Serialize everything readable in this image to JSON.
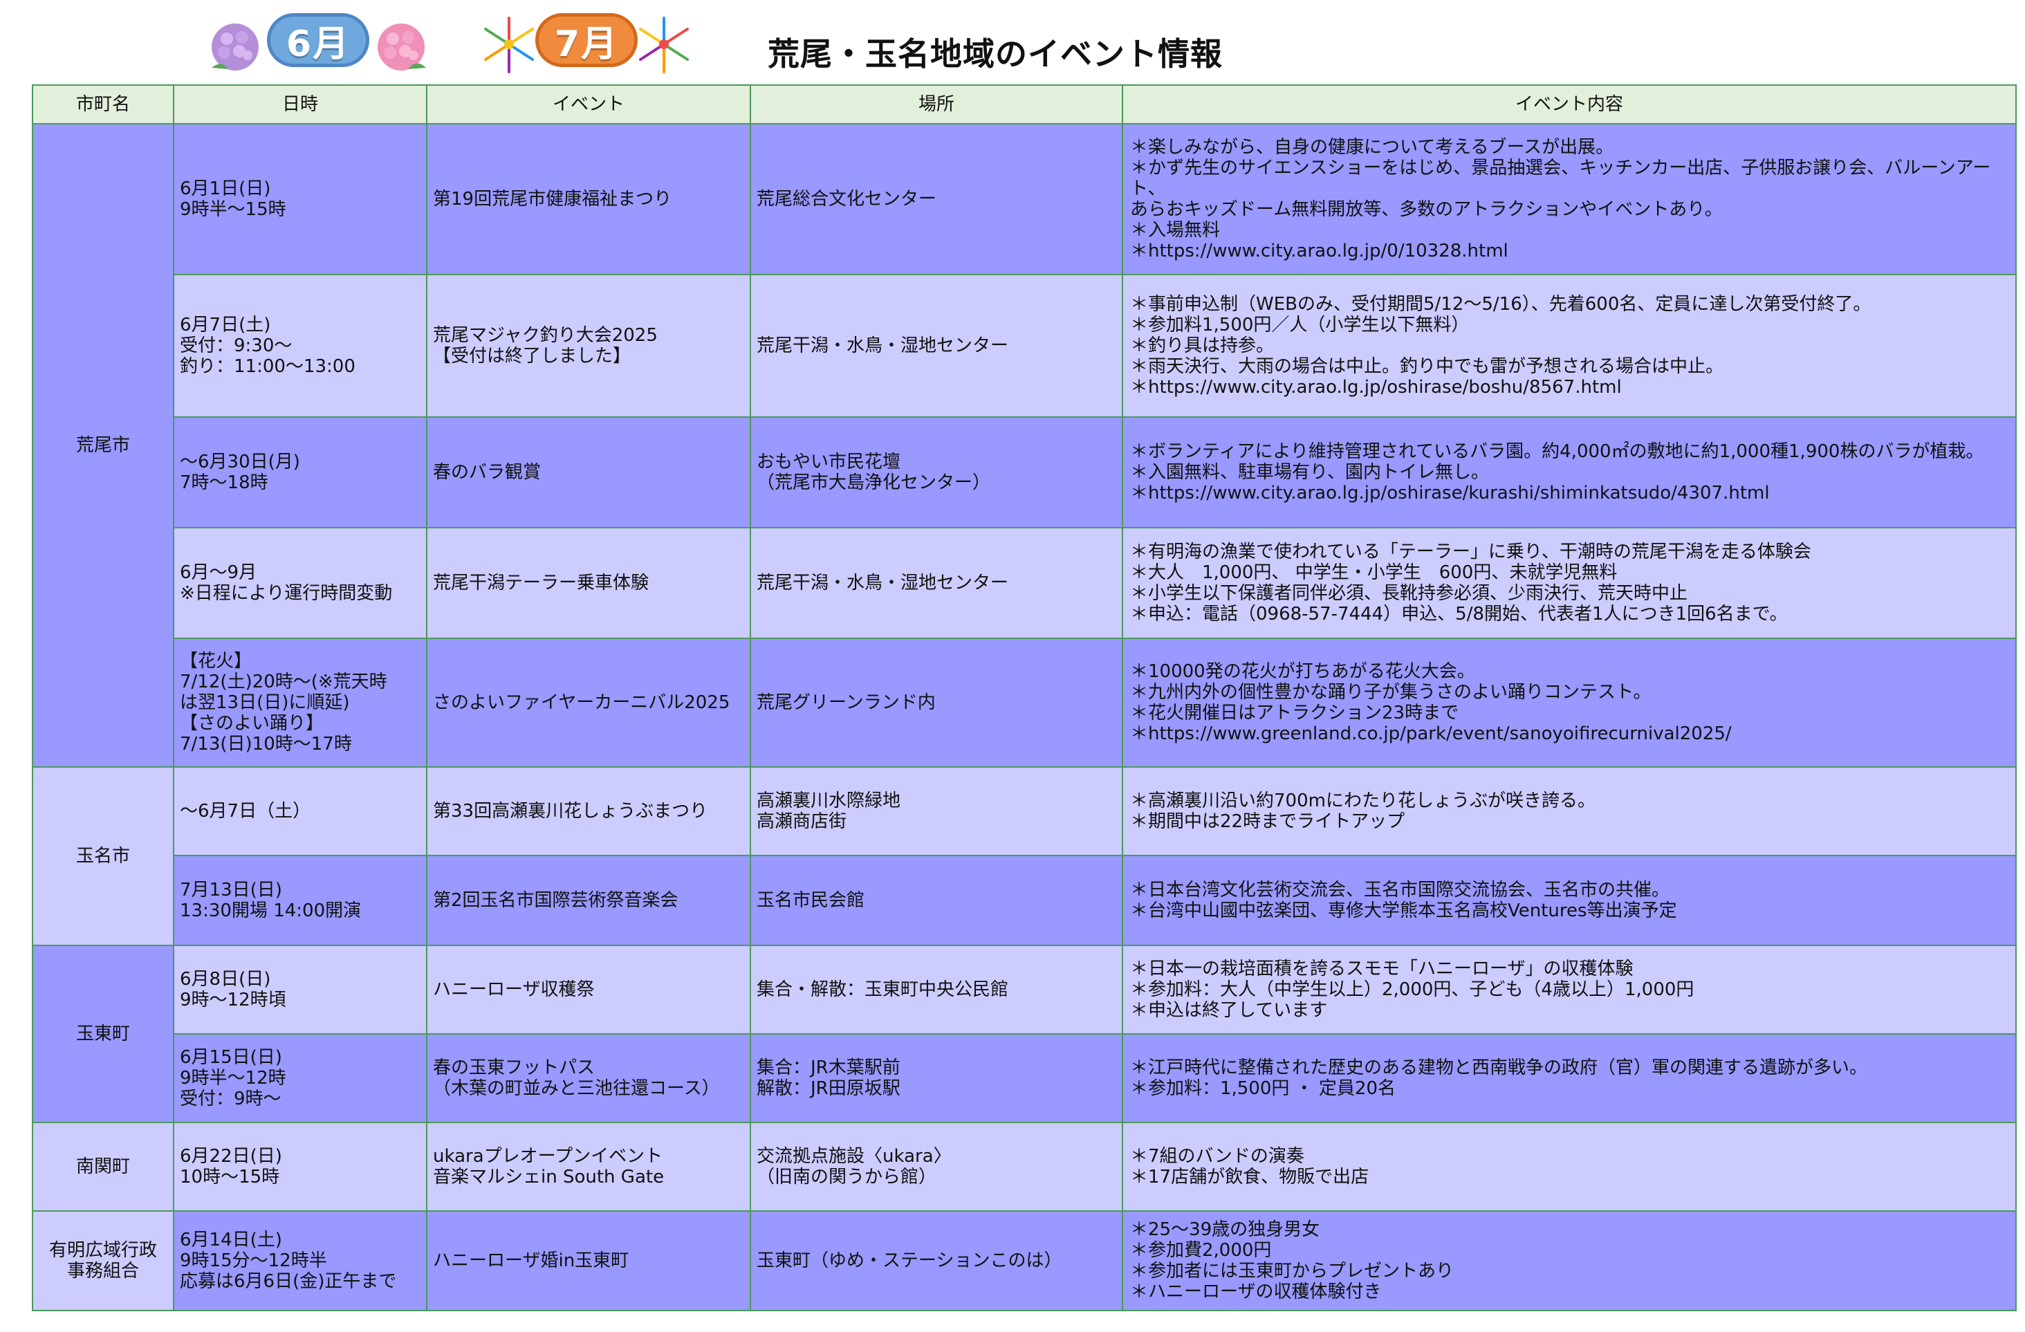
{
  "header": {
    "badges": [
      "6月",
      "7月"
    ],
    "title": "荒尾・玉名地域のイベント情報"
  },
  "colors": {
    "dark_row": "#9999ff",
    "light_row": "#ccccff",
    "header_row": "#e2efda",
    "border": "#4a9a5c"
  },
  "table": {
    "columns": [
      "市町名",
      "日時",
      "イベント",
      "場所",
      "イベント内容"
    ],
    "groups": [
      {
        "municipality": "荒尾市",
        "rows": [
          {
            "date": "6月1日(日)\n  9時半～15時",
            "event": "第19回荒尾市健康福祉まつり",
            "place": "荒尾総合文化センター",
            "content": "＊楽しみながら、自身の健康について考えるブースが出展。\n＊かず先生のサイエンスショーをはじめ、景品抽選会、キッチンカー出店、子供服お譲り会、バルーンアート、\n  あらおキッズドーム無料開放等、多数のアトラクションやイベントあり。\n＊入場無料\n＊https://www.city.arao.lg.jp/0/10328.html"
          },
          {
            "date": "6月7日(土)\n  受付：9:30～\n  釣り：11:00～13:00",
            "event": "荒尾マジャク釣り大会2025\n【受付は終了しました】",
            "place": "荒尾干潟・水鳥・湿地センター",
            "content": "＊事前申込制（WEBのみ、受付期間5/12～5/16）、先着600名、定員に達し次第受付終了。\n＊参加料1,500円／人（小学生以下無料）\n＊釣り具は持参。\n＊雨天決行、大雨の場合は中止。釣り中でも雷が予想される場合は中止。\n＊https://www.city.arao.lg.jp/oshirase/boshu/8567.html"
          },
          {
            "date": "～6月30日(月)\n    7時～18時",
            "event": "春のバラ観賞",
            "place": "おもやい市民花壇\n（荒尾市大島浄化センター）",
            "content": "＊ボランティアにより維持管理されているバラ園。約4,000㎡の敷地に約1,000種1,900株のバラが植栽。\n＊入園無料、駐車場有り、園内トイレ無し。\n＊https://www.city.arao.lg.jp/oshirase/kurashi/shiminkatsudo/4307.html"
          },
          {
            "date": "6月～9月\n  ※日程により運行時間変動",
            "event": "荒尾干潟テーラー乗車体験",
            "place": "荒尾干潟・水鳥・湿地センター",
            "content": "＊有明海の漁業で使われている「テーラー」に乗り、干潮時の荒尾干潟を走る体験会\n＊大人　1,000円、 中学生・小学生　600円、未就学児無料\n＊小学生以下保護者同伴必須、長靴持参必須、少雨決行、荒天時中止\n＊申込：電話（0968-57-7444）申込、5/8開始、代表者1人につき1回6名まで。"
          },
          {
            "date": "【花火】\n7/12(土)20時～(※荒天時\nは翌13日(日)に順延)\n【さのよい踊り】\n7/13(日)10時～17時",
            "event": "さのよいファイヤーカーニバル2025",
            "place": "荒尾グリーンランド内",
            "content": "＊10000発の花火が打ちあがる花火大会。\n＊九州内外の個性豊かな踊り子が集うさのよい踊りコンテスト。\n＊花火開催日はアトラクション23時まで\n＊https://www.greenland.co.jp/park/event/sanoyoifirecurnival2025/"
          }
        ]
      },
      {
        "municipality": "玉名市",
        "rows": [
          {
            "date": "～6月7日（土）",
            "event": "第33回高瀬裏川花しょうぶまつり",
            "place": "高瀬裏川水際緑地\n高瀬商店街",
            "content": "＊高瀬裏川沿い約700mにわたり花しょうぶが咲き誇る。\n＊期間中は22時までライトアップ"
          },
          {
            "date": "7月13日(日)\n  13:30開場  14:00開演",
            "event": "第2回玉名市国際芸術祭音楽会",
            "place": "玉名市民会館",
            "content": "＊日本台湾文化芸術交流会、玉名市国際交流協会、玉名市の共催。\n＊台湾中山國中弦楽団、専修大学熊本玉名高校Ventures等出演予定"
          }
        ]
      },
      {
        "municipality": "玉東町",
        "rows": [
          {
            "date": "6月8日(日)\n  9時～12時頃",
            "event": "ハニーローザ収穫祭",
            "place": "集合・解散：玉東町中央公民館",
            "content": "＊日本一の栽培面積を誇るスモモ「ハニーローザ」の収穫体験\n＊参加料：大人（中学生以上）2,000円、子ども（4歳以上）1,000円\n＊申込は終了しています"
          },
          {
            "date": "6月15日(日)\n  9時半～12時\n    受付：9時～",
            "event": "春の玉東フットパス\n（木葉の町並みと三池往還コース）",
            "place": "集合：JR木葉駅前\n解散：JR田原坂駅",
            "content": "＊江戸時代に整備された歴史のある建物と西南戦争の政府（官）軍の関連する遺跡が多い。\n＊参加料：1,500円 ・ 定員20名"
          }
        ]
      },
      {
        "municipality": "南関町",
        "rows": [
          {
            "date": "6月22日(日)\n  10時～15時",
            "event": "ukaraプレオープンイベント\n音楽マルシェin South Gate",
            "place": "交流拠点施設〈ukara〉\n（旧南の関うから館）",
            "content": "＊7組のバンドの演奏\n＊17店舗が飲食、物販で出店"
          }
        ]
      },
      {
        "municipality": "有明広域行政\n事務組合",
        "rows": [
          {
            "date": "6月14日(土)\n  9時15分～12時半\n  応募は6月6日(金)正午まで",
            "event": "ハニーローザ婚in玉東町",
            "place": "玉東町（ゆめ・ステーションこのは）",
            "content": "＊25～39歳の独身男女\n＊参加費2,000円\n＊参加者には玉東町からプレゼントあり\n＊ハニーローザの収穫体験付き"
          }
        ]
      }
    ]
  }
}
